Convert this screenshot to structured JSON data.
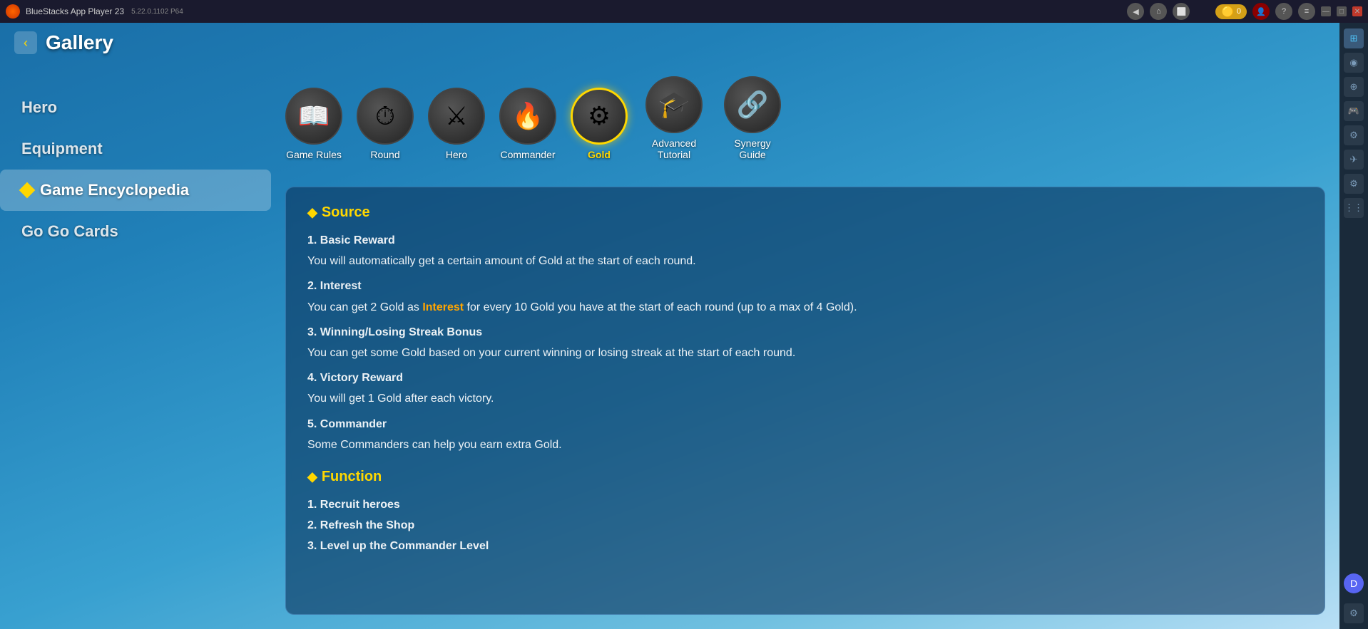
{
  "titleBar": {
    "appName": "BlueStacks App Player 23",
    "version": "5.22.0.1102  P64",
    "coinCount": "0"
  },
  "header": {
    "backLabel": "‹",
    "title": "Gallery"
  },
  "leftSidebar": {
    "items": [
      {
        "id": "hero",
        "label": "Hero",
        "active": false
      },
      {
        "id": "equipment",
        "label": "Equipment",
        "active": false
      },
      {
        "id": "game-encyclopedia",
        "label": "Game Encyclopedia",
        "active": true
      },
      {
        "id": "go-go-cards",
        "label": "Go Go Cards",
        "active": false
      }
    ]
  },
  "categories": [
    {
      "id": "game-rules",
      "label": "Game Rules",
      "icon": "📖",
      "active": false
    },
    {
      "id": "round",
      "label": "Round",
      "icon": "⏱",
      "active": false
    },
    {
      "id": "hero",
      "label": "Hero",
      "icon": "⚔",
      "active": false
    },
    {
      "id": "commander",
      "label": "Commander",
      "icon": "🔥",
      "active": false
    },
    {
      "id": "gold",
      "label": "Gold",
      "icon": "⚙",
      "active": true
    },
    {
      "id": "advanced-tutorial",
      "label": "Advanced Tutorial",
      "icon": "🎓",
      "active": false
    },
    {
      "id": "synergy-guide",
      "label": "Synergy Guide",
      "icon": "🔗",
      "active": false
    }
  ],
  "content": {
    "sections": [
      {
        "id": "source",
        "title": "Source",
        "items": [
          {
            "type": "numbered",
            "text": "1. Basic Reward"
          },
          {
            "type": "description",
            "text": "You will automatically get a certain amount of Gold at the start of each round."
          },
          {
            "type": "numbered",
            "text": "2. Interest"
          },
          {
            "type": "description",
            "textBefore": "You can get 2 Gold as ",
            "highlight": "Interest",
            "textAfter": " for every 10 Gold you have at the start of each round (up to a max of 4 Gold)."
          },
          {
            "type": "numbered",
            "text": "3. Winning/Losing Streak Bonus"
          },
          {
            "type": "description",
            "text": "You can get some Gold based on your current winning or losing streak at the start of each round."
          },
          {
            "type": "numbered",
            "text": "4. Victory Reward"
          },
          {
            "type": "description",
            "text": "You will get 1 Gold after each victory."
          },
          {
            "type": "numbered",
            "text": "5. Commander"
          },
          {
            "type": "description",
            "text": "Some Commanders can help you earn extra Gold."
          }
        ]
      },
      {
        "id": "function",
        "title": "Function",
        "items": [
          {
            "type": "numbered",
            "text": "1. Recruit heroes"
          },
          {
            "type": "numbered",
            "text": "2. Refresh the Shop"
          },
          {
            "type": "numbered",
            "text": "3. Level up the Commander Level"
          }
        ]
      }
    ]
  },
  "rightSidebar": {
    "icons": [
      "⚙",
      "🌐",
      "⚙",
      "🎮",
      "🔧",
      "✈",
      "⚙"
    ]
  }
}
